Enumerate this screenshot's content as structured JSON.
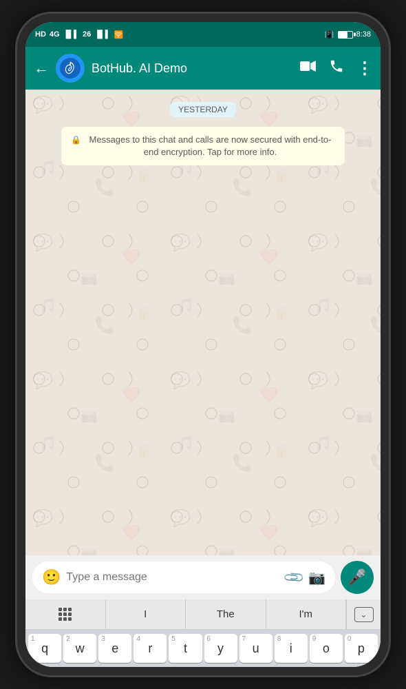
{
  "statusBar": {
    "left": [
      "HD",
      "4G",
      "26",
      "wifi"
    ],
    "time": "8:38",
    "icons": [
      "vibrate",
      "battery"
    ]
  },
  "header": {
    "backLabel": "←",
    "contactName": "BotHub. AI Demo",
    "icons": {
      "video": "📹",
      "call": "📞",
      "more": "⋮"
    }
  },
  "chat": {
    "dateBadge": "YESTERDAY",
    "encryptionNotice": "Messages to this chat and calls are now secured with end-to-end encryption. Tap for more info."
  },
  "inputArea": {
    "placeholder": "Type a message"
  },
  "keyboard": {
    "suggestions": [
      "I",
      "The",
      "I'm"
    ],
    "rows": [
      [
        {
          "num": "1",
          "letter": "q"
        },
        {
          "num": "2",
          "letter": "w"
        },
        {
          "num": "3",
          "letter": "e"
        },
        {
          "num": "4",
          "letter": "r"
        },
        {
          "num": "5",
          "letter": "t"
        },
        {
          "num": "6",
          "letter": "y"
        },
        {
          "num": "7",
          "letter": "u"
        },
        {
          "num": "8",
          "letter": "i"
        },
        {
          "num": "9",
          "letter": "o"
        },
        {
          "num": "0",
          "letter": "p"
        }
      ]
    ]
  }
}
